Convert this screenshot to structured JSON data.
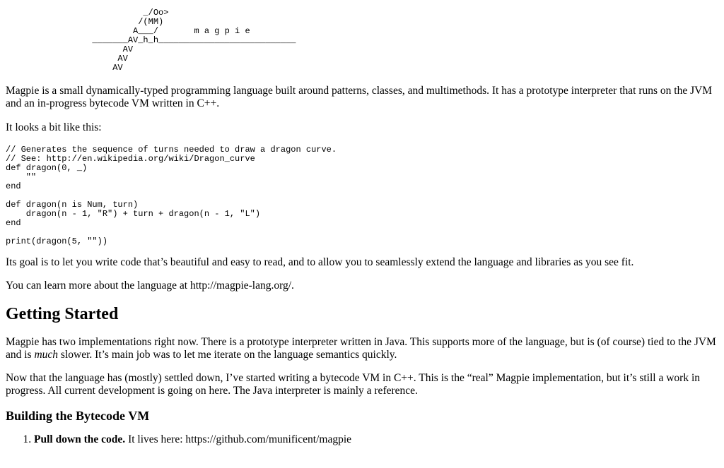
{
  "logo_ascii": "                           _/Oo>\n                          /(MM)\n                         A___/       m a g p i e\n                 _______AV_h_h___________________________\n                       AV\n                      AV\n                     AV",
  "intro": "Magpie is a small dynamically-typed programming language built around patterns, classes, and multimethods. It has a prototype interpreter that runs on the JVM and an in-progress bytecode VM written in C++.",
  "looks_like": "It looks a bit like this:",
  "code_sample": "// Generates the sequence of turns needed to draw a dragon curve.\n// See: http://en.wikipedia.org/wiki/Dragon_curve\ndef dragon(0, _)\n    \"\"\nend\n\ndef dragon(n is Num, turn)\n    dragon(n - 1, \"R\") + turn + dragon(n - 1, \"L\")\nend\n\nprint(dragon(5, \"\"))",
  "goal": "Its goal is to let you write code that’s beautiful and easy to read, and to allow you to seamlessly extend the language and libraries as you see fit.",
  "learn_more": "You can learn more about the language at http://magpie-lang.org/.",
  "getting_started_heading": "Getting Started",
  "implementations": {
    "before_em": "Magpie has two implementations right now. There is a prototype interpreter written in Java. This supports more of the language, but is (of course) tied to the JVM and is ",
    "em": "much",
    "after_em": " slower. It’s main job was to let me iterate on the language semantics quickly."
  },
  "now_settled": "Now that the language has (mostly) settled down, I’ve started writing a bytecode VM in C++. This is the “real” Magpie implementation, but it’s still a work in progress. All current development is going on here. The Java interpreter is mainly a reference.",
  "building_heading": "Building the Bytecode VM",
  "steps": [
    {
      "bold": "Pull down the code.",
      "text": " It lives here: https://github.com/munificent/magpie"
    }
  ]
}
